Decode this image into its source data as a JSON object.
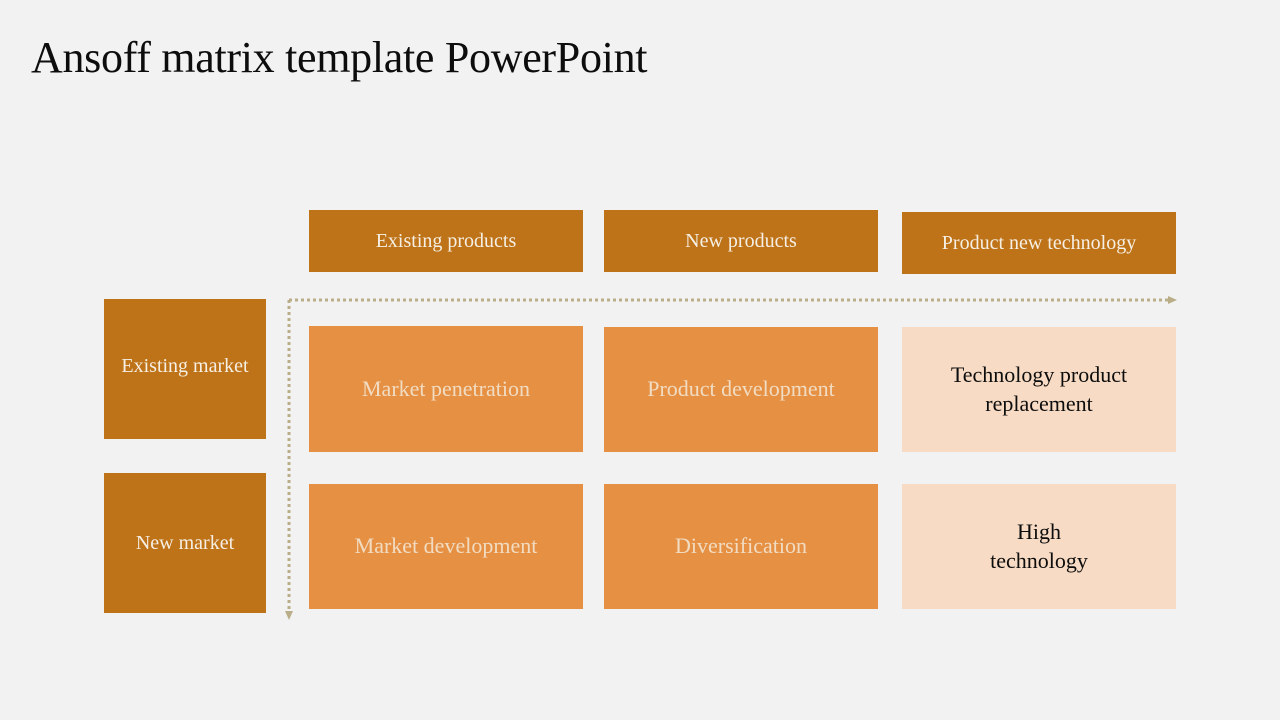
{
  "title": "Ansoff matrix template PowerPoint",
  "colors": {
    "background": "#f2f2f2",
    "header_fill": "#bf7318",
    "strategy_fill": "#e69044",
    "technology_fill": "#f7dbc4",
    "connector": "#b9ae87"
  },
  "columns": [
    {
      "label": "Existing products"
    },
    {
      "label": "New products"
    },
    {
      "label": "Product new technology"
    }
  ],
  "rows": [
    {
      "label": "Existing market"
    },
    {
      "label": "New market"
    }
  ],
  "cells": [
    [
      "Market penetration",
      "Product development",
      "Technology product replacement"
    ],
    [
      "Market development",
      "Diversification",
      "High technology"
    ]
  ],
  "connector": {
    "style": "dotted",
    "horizontal_arrow": "right",
    "vertical_arrow": "down"
  }
}
